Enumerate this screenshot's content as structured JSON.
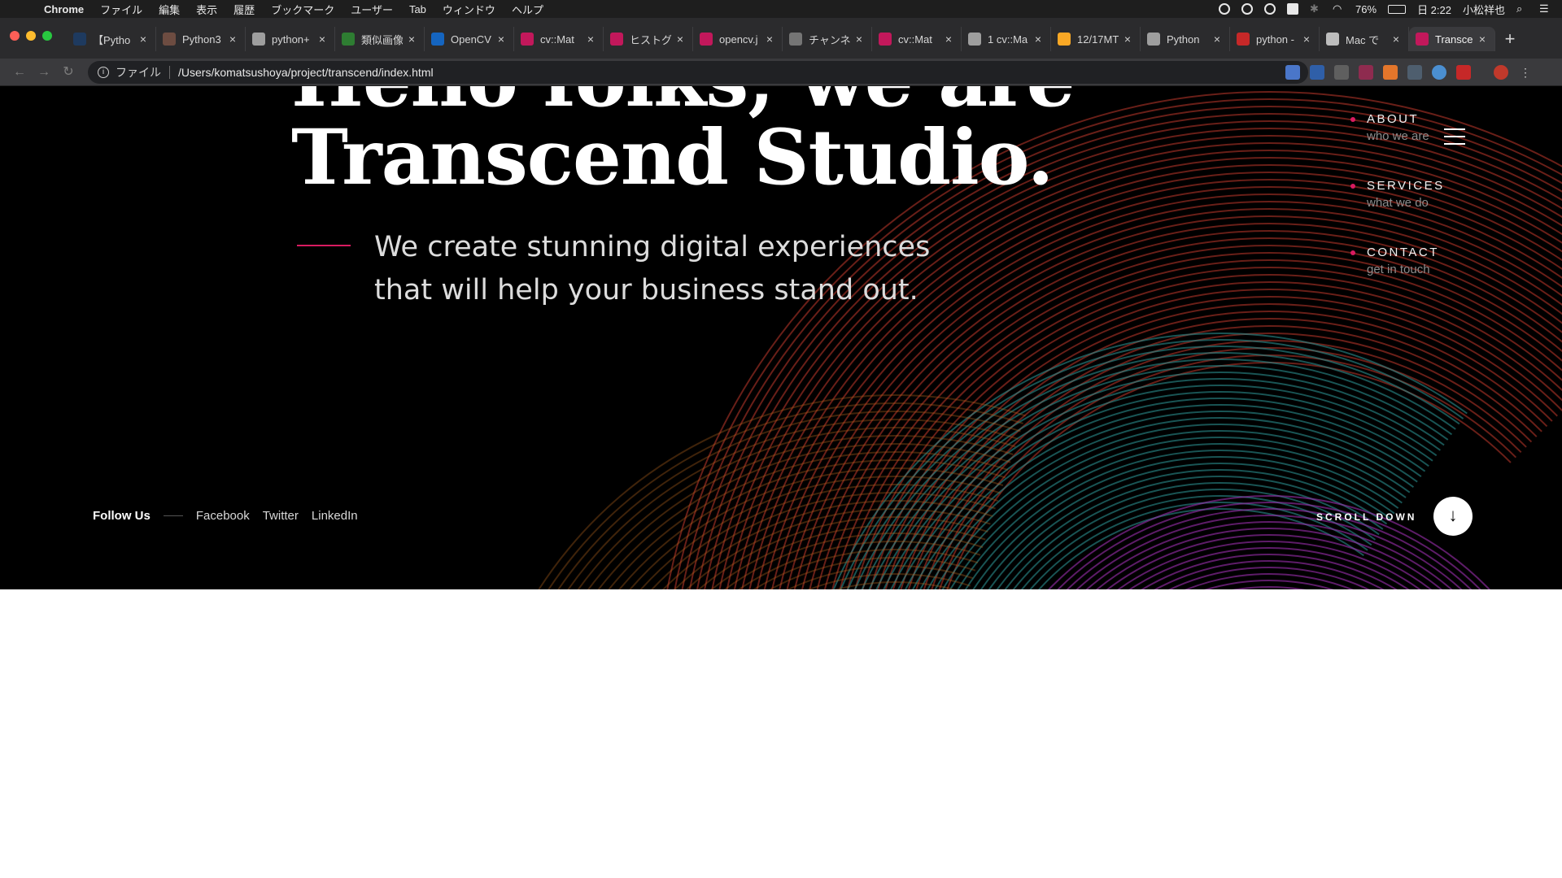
{
  "menubar": {
    "app_name": "Chrome",
    "items": [
      "ファイル",
      "編集",
      "表示",
      "履歴",
      "ブックマーク",
      "ユーザー",
      "Tab",
      "ウィンドウ",
      "ヘルプ"
    ],
    "battery": "76%",
    "clock": "日 2:22",
    "user": "小松祥也"
  },
  "tabs": [
    {
      "title": "【Pytho",
      "favicon_color": "#1e3a5f"
    },
    {
      "title": "Python3",
      "favicon_color": "#6d4c41"
    },
    {
      "title": "python+",
      "favicon_color": "#9e9e9e"
    },
    {
      "title": "類似画像",
      "favicon_color": "#2e7d32"
    },
    {
      "title": "OpenCV",
      "favicon_color": "#1565c0"
    },
    {
      "title": "cv::Mat",
      "favicon_color": "#c2185b"
    },
    {
      "title": "ヒストグ",
      "favicon_color": "#c2185b"
    },
    {
      "title": "opencv.j",
      "favicon_color": "#c2185b"
    },
    {
      "title": "チャンネ",
      "favicon_color": "#757575"
    },
    {
      "title": "cv::Mat",
      "favicon_color": "#c2185b"
    },
    {
      "title": "1 cv::Ma",
      "favicon_color": "#9e9e9e"
    },
    {
      "title": "12/17MT",
      "favicon_color": "#f9a825"
    },
    {
      "title": "Python",
      "favicon_color": "#9e9e9e"
    },
    {
      "title": "python -",
      "favicon_color": "#c62828"
    },
    {
      "title": "Mac で",
      "favicon_color": "#bdbdbd"
    },
    {
      "title": "Transce",
      "favicon_color": "#c2185b"
    }
  ],
  "address_bar": {
    "scheme_label": "ファイル",
    "url": "/Users/komatsushoya/project/transcend/index.html"
  },
  "hero": {
    "headline_line1": "Hello folks, we are",
    "headline_line2": "Transcend Studio.",
    "tagline_line1": "We create stunning digital experiences",
    "tagline_line2": "that will help your business stand out."
  },
  "nav": [
    {
      "title": "ABOUT",
      "sub": "who we are"
    },
    {
      "title": "SERVICES",
      "sub": "what we do"
    },
    {
      "title": "CONTACT",
      "sub": "get in touch"
    }
  ],
  "follow": {
    "label": "Follow Us",
    "links": [
      "Facebook",
      "Twitter",
      "LinkedIn"
    ]
  },
  "scroll": {
    "label": "SCROLL DOWN",
    "arrow": "↓"
  },
  "colors": {
    "accent": "#d81b60",
    "background": "#000000"
  }
}
